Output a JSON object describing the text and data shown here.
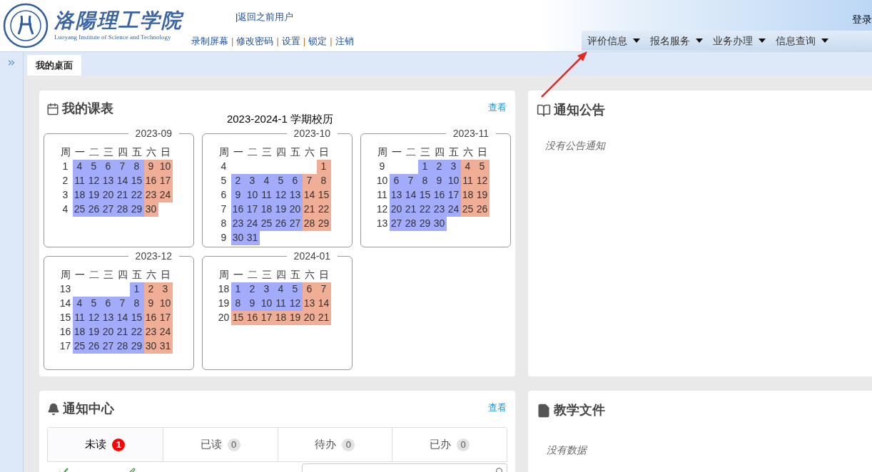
{
  "header": {
    "school_name": "洛陽理工学院",
    "school_name_en": "Luoyang Institute of Science and Technology",
    "return_link": {
      "separator": "|",
      "label": "返回之前用户"
    },
    "links": [
      "录制屏幕",
      "修改密码",
      "设置",
      "锁定",
      "注销"
    ],
    "link_separator": "|",
    "login_info": "登录"
  },
  "nav": [
    {
      "label": "评价信息"
    },
    {
      "label": "报名服务"
    },
    {
      "label": "业务办理"
    },
    {
      "label": "信息查询"
    }
  ],
  "tabs": [
    {
      "label": "我的桌面",
      "selected": true
    }
  ],
  "schedule": {
    "title": "我的课表",
    "view_link": "查看",
    "calendar_title": "2023-2024-1 学期校历",
    "months": [
      {
        "title": "2023-09",
        "header": [
          "周",
          "一",
          "二",
          "三",
          "四",
          "五",
          "六",
          "日"
        ],
        "weeks": [
          {
            "week": "1",
            "days": [
              {
                "day": "4",
                "kind": "workday"
              },
              {
                "day": "5",
                "kind": "workday"
              },
              {
                "day": "6",
                "kind": "workday"
              },
              {
                "day": "7",
                "kind": "workday"
              },
              {
                "day": "8",
                "kind": "workday"
              },
              {
                "day": "9",
                "kind": "holiday"
              },
              {
                "day": "10",
                "kind": "holiday"
              }
            ]
          },
          {
            "week": "2",
            "days": [
              {
                "day": "11",
                "kind": "workday"
              },
              {
                "day": "12",
                "kind": "workday"
              },
              {
                "day": "13",
                "kind": "workday"
              },
              {
                "day": "14",
                "kind": "workday"
              },
              {
                "day": "15",
                "kind": "workday"
              },
              {
                "day": "16",
                "kind": "holiday"
              },
              {
                "day": "17",
                "kind": "holiday"
              }
            ]
          },
          {
            "week": "3",
            "days": [
              {
                "day": "18",
                "kind": "workday"
              },
              {
                "day": "19",
                "kind": "workday"
              },
              {
                "day": "20",
                "kind": "workday"
              },
              {
                "day": "21",
                "kind": "workday"
              },
              {
                "day": "22",
                "kind": "workday"
              },
              {
                "day": "23",
                "kind": "holiday"
              },
              {
                "day": "24",
                "kind": "holiday"
              }
            ]
          },
          {
            "week": "4",
            "days": [
              {
                "day": "25",
                "kind": "workday"
              },
              {
                "day": "26",
                "kind": "workday"
              },
              {
                "day": "27",
                "kind": "workday"
              },
              {
                "day": "28",
                "kind": "workday"
              },
              {
                "day": "29",
                "kind": "workday"
              },
              {
                "day": "30",
                "kind": "holiday"
              }
            ]
          }
        ]
      },
      {
        "title": "2023-10",
        "header": [
          "周",
          "一",
          "二",
          "三",
          "四",
          "五",
          "六",
          "日"
        ],
        "weeks": [
          {
            "week": "4",
            "days": [
              {
                "kind": "blank"
              },
              {
                "kind": "blank"
              },
              {
                "kind": "blank"
              },
              {
                "kind": "blank"
              },
              {
                "kind": "blank"
              },
              {
                "kind": "blank"
              },
              {
                "day": "1",
                "kind": "holiday"
              }
            ]
          },
          {
            "week": "5",
            "days": [
              {
                "day": "2",
                "kind": "workday"
              },
              {
                "day": "3",
                "kind": "workday"
              },
              {
                "day": "4",
                "kind": "workday"
              },
              {
                "day": "5",
                "kind": "workday"
              },
              {
                "day": "6",
                "kind": "workday"
              },
              {
                "day": "7",
                "kind": "holiday"
              },
              {
                "day": "8",
                "kind": "holiday"
              }
            ]
          },
          {
            "week": "6",
            "days": [
              {
                "day": "9",
                "kind": "workday"
              },
              {
                "day": "10",
                "kind": "workday"
              },
              {
                "day": "11",
                "kind": "workday"
              },
              {
                "day": "12",
                "kind": "workday"
              },
              {
                "day": "13",
                "kind": "workday"
              },
              {
                "day": "14",
                "kind": "holiday"
              },
              {
                "day": "15",
                "kind": "holiday"
              }
            ]
          },
          {
            "week": "7",
            "days": [
              {
                "day": "16",
                "kind": "workday"
              },
              {
                "day": "17",
                "kind": "workday"
              },
              {
                "day": "18",
                "kind": "workday"
              },
              {
                "day": "19",
                "kind": "workday"
              },
              {
                "day": "20",
                "kind": "workday"
              },
              {
                "day": "21",
                "kind": "holiday"
              },
              {
                "day": "22",
                "kind": "holiday"
              }
            ]
          },
          {
            "week": "8",
            "days": [
              {
                "day": "23",
                "kind": "workday"
              },
              {
                "day": "24",
                "kind": "workday"
              },
              {
                "day": "25",
                "kind": "workday"
              },
              {
                "day": "26",
                "kind": "workday"
              },
              {
                "day": "27",
                "kind": "workday"
              },
              {
                "day": "28",
                "kind": "holiday"
              },
              {
                "day": "29",
                "kind": "holiday"
              }
            ]
          },
          {
            "week": "9",
            "days": [
              {
                "day": "30",
                "kind": "workday"
              },
              {
                "day": "31",
                "kind": "workday"
              }
            ]
          }
        ]
      },
      {
        "title": "2023-11",
        "header": [
          "周",
          "一",
          "二",
          "三",
          "四",
          "五",
          "六",
          "日"
        ],
        "weeks": [
          {
            "week": "9",
            "days": [
              {
                "kind": "blank"
              },
              {
                "kind": "blank"
              },
              {
                "day": "1",
                "kind": "workday"
              },
              {
                "day": "2",
                "kind": "workday"
              },
              {
                "day": "3",
                "kind": "workday"
              },
              {
                "day": "4",
                "kind": "holiday"
              },
              {
                "day": "5",
                "kind": "holiday"
              }
            ]
          },
          {
            "week": "10",
            "days": [
              {
                "day": "6",
                "kind": "workday"
              },
              {
                "day": "7",
                "kind": "workday"
              },
              {
                "day": "8",
                "kind": "workday"
              },
              {
                "day": "9",
                "kind": "workday"
              },
              {
                "day": "10",
                "kind": "workday"
              },
              {
                "day": "11",
                "kind": "holiday"
              },
              {
                "day": "12",
                "kind": "holiday"
              }
            ]
          },
          {
            "week": "11",
            "days": [
              {
                "day": "13",
                "kind": "workday"
              },
              {
                "day": "14",
                "kind": "workday"
              },
              {
                "day": "15",
                "kind": "workday"
              },
              {
                "day": "16",
                "kind": "workday"
              },
              {
                "day": "17",
                "kind": "workday"
              },
              {
                "day": "18",
                "kind": "holiday"
              },
              {
                "day": "19",
                "kind": "holiday"
              }
            ]
          },
          {
            "week": "12",
            "days": [
              {
                "day": "20",
                "kind": "workday"
              },
              {
                "day": "21",
                "kind": "workday"
              },
              {
                "day": "22",
                "kind": "workday"
              },
              {
                "day": "23",
                "kind": "workday"
              },
              {
                "day": "24",
                "kind": "workday"
              },
              {
                "day": "25",
                "kind": "holiday"
              },
              {
                "day": "26",
                "kind": "holiday"
              }
            ]
          },
          {
            "week": "13",
            "days": [
              {
                "day": "27",
                "kind": "workday"
              },
              {
                "day": "28",
                "kind": "workday"
              },
              {
                "day": "29",
                "kind": "workday"
              },
              {
                "day": "30",
                "kind": "workday"
              }
            ]
          }
        ]
      },
      {
        "title": "2023-12",
        "header": [
          "周",
          "一",
          "二",
          "三",
          "四",
          "五",
          "六",
          "日"
        ],
        "weeks": [
          {
            "week": "13",
            "days": [
              {
                "kind": "blank"
              },
              {
                "kind": "blank"
              },
              {
                "kind": "blank"
              },
              {
                "kind": "blank"
              },
              {
                "day": "1",
                "kind": "workday"
              },
              {
                "day": "2",
                "kind": "holiday"
              },
              {
                "day": "3",
                "kind": "holiday"
              }
            ]
          },
          {
            "week": "14",
            "days": [
              {
                "day": "4",
                "kind": "workday"
              },
              {
                "day": "5",
                "kind": "workday"
              },
              {
                "day": "6",
                "kind": "workday"
              },
              {
                "day": "7",
                "kind": "workday"
              },
              {
                "day": "8",
                "kind": "workday"
              },
              {
                "day": "9",
                "kind": "holiday"
              },
              {
                "day": "10",
                "kind": "holiday"
              }
            ]
          },
          {
            "week": "15",
            "days": [
              {
                "day": "11",
                "kind": "workday"
              },
              {
                "day": "12",
                "kind": "workday"
              },
              {
                "day": "13",
                "kind": "workday"
              },
              {
                "day": "14",
                "kind": "workday"
              },
              {
                "day": "15",
                "kind": "workday"
              },
              {
                "day": "16",
                "kind": "holiday"
              },
              {
                "day": "17",
                "kind": "holiday"
              }
            ]
          },
          {
            "week": "16",
            "days": [
              {
                "day": "18",
                "kind": "workday"
              },
              {
                "day": "19",
                "kind": "workday"
              },
              {
                "day": "20",
                "kind": "workday"
              },
              {
                "day": "21",
                "kind": "workday"
              },
              {
                "day": "22",
                "kind": "workday"
              },
              {
                "day": "23",
                "kind": "holiday"
              },
              {
                "day": "24",
                "kind": "holiday"
              }
            ]
          },
          {
            "week": "17",
            "days": [
              {
                "day": "25",
                "kind": "workday"
              },
              {
                "day": "26",
                "kind": "workday"
              },
              {
                "day": "27",
                "kind": "workday"
              },
              {
                "day": "28",
                "kind": "workday"
              },
              {
                "day": "29",
                "kind": "workday"
              },
              {
                "day": "30",
                "kind": "holiday"
              },
              {
                "day": "31",
                "kind": "holiday"
              }
            ]
          }
        ]
      },
      {
        "title": "2024-01",
        "header": [
          "周",
          "一",
          "二",
          "三",
          "四",
          "五",
          "六",
          "日"
        ],
        "weeks": [
          {
            "week": "18",
            "days": [
              {
                "day": "1",
                "kind": "workday"
              },
              {
                "day": "2",
                "kind": "workday"
              },
              {
                "day": "3",
                "kind": "workday"
              },
              {
                "day": "4",
                "kind": "workday"
              },
              {
                "day": "5",
                "kind": "workday"
              },
              {
                "day": "6",
                "kind": "holiday"
              },
              {
                "day": "7",
                "kind": "holiday"
              }
            ]
          },
          {
            "week": "19",
            "days": [
              {
                "day": "8",
                "kind": "workday"
              },
              {
                "day": "9",
                "kind": "workday"
              },
              {
                "day": "10",
                "kind": "workday"
              },
              {
                "day": "11",
                "kind": "workday"
              },
              {
                "day": "12",
                "kind": "workday"
              },
              {
                "day": "13",
                "kind": "holiday"
              },
              {
                "day": "14",
                "kind": "holiday"
              }
            ]
          },
          {
            "week": "20",
            "days": [
              {
                "day": "15",
                "kind": "holiday"
              },
              {
                "day": "16",
                "kind": "holiday"
              },
              {
                "day": "17",
                "kind": "holiday"
              },
              {
                "day": "18",
                "kind": "holiday"
              },
              {
                "day": "19",
                "kind": "holiday"
              },
              {
                "day": "20",
                "kind": "holiday"
              },
              {
                "day": "21",
                "kind": "holiday"
              }
            ]
          }
        ]
      }
    ]
  },
  "announcements": {
    "title": "通知公告",
    "empty_text": "没有公告通知"
  },
  "notice_center": {
    "title": "通知中心",
    "view_link": "查看",
    "tabs": [
      {
        "label": "未读",
        "count": "1",
        "highlighted": true,
        "selected": true
      },
      {
        "label": "已读",
        "count": "0",
        "highlighted": false,
        "selected": false
      },
      {
        "label": "待办",
        "count": "0",
        "highlighted": false,
        "selected": false
      },
      {
        "label": "已办",
        "count": "0",
        "highlighted": false,
        "selected": false
      }
    ],
    "actions": [
      {
        "kind": "check"
      },
      {
        "kind": "clear"
      }
    ]
  },
  "teaching_files": {
    "title": "教学文件",
    "empty_text": "没有数据"
  }
}
